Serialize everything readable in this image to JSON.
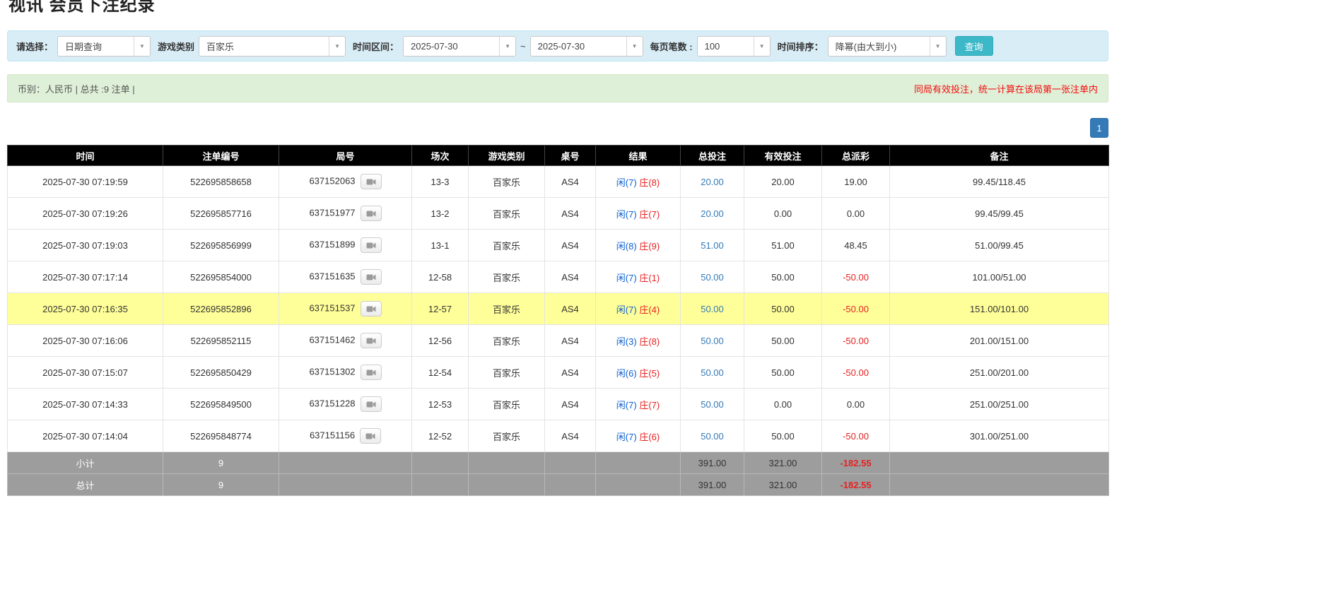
{
  "page": {
    "title": "视讯 会员下注纪录"
  },
  "icons": {
    "caret": "▼",
    "replay": "video-replay",
    "replay_color": "#9a9a9a"
  },
  "colors": {
    "filter_bar_bg": "#d9edf7",
    "summary_bar_bg": "#dff0d8",
    "query_button": "#3cb8c8",
    "pagination_blue": "#337ab7",
    "highlight_row": "#ffff99",
    "player_blue": "#0b5fd0",
    "banker_red": "#e62222",
    "negative_red": "#e62222",
    "header_bg": "#000000",
    "footer_bg": "#9d9d9d"
  },
  "filters": {
    "select_label": "请选择：",
    "select_value": "日期查询",
    "game_type_label": "游戏类别",
    "game_type_value": "百家乐",
    "time_range_label": "时间区间：",
    "time_from": "2025-07-30",
    "tilde": "~",
    "time_to": "2025-07-30",
    "page_size_label": "每页笔数 :",
    "page_size_value": "100",
    "sort_label": "时间排序：",
    "sort_value": "降幂(由大到小)",
    "query_button": "查询"
  },
  "summary": {
    "left": "币别：人民币 | 总共 :9 注单 |",
    "right": "同局有效投注，统一计算在该局第一张注单内"
  },
  "pagination": {
    "current": "1"
  },
  "table": {
    "headers": [
      "时间",
      "注单编号",
      "局号",
      "场次",
      "游戏类别",
      "桌号",
      "结果",
      "总投注",
      "有效投注",
      "总派彩",
      "备注"
    ],
    "rows": [
      {
        "time": "2025-07-30 07:19:59",
        "bet_id": "522695858658",
        "round_id": "637152063",
        "session": "13-3",
        "game": "百家乐",
        "table_no": "AS4",
        "result_player": "闲(7)",
        "result_banker": "庄(8)",
        "total_bet": "20.00",
        "valid_bet": "20.00",
        "payout": "19.00",
        "note": "99.45/118.45",
        "highlight": false
      },
      {
        "time": "2025-07-30 07:19:26",
        "bet_id": "522695857716",
        "round_id": "637151977",
        "session": "13-2",
        "game": "百家乐",
        "table_no": "AS4",
        "result_player": "闲(7)",
        "result_banker": "庄(7)",
        "total_bet": "20.00",
        "valid_bet": "0.00",
        "payout": "0.00",
        "note": "99.45/99.45",
        "highlight": false
      },
      {
        "time": "2025-07-30 07:19:03",
        "bet_id": "522695856999",
        "round_id": "637151899",
        "session": "13-1",
        "game": "百家乐",
        "table_no": "AS4",
        "result_player": "闲(8)",
        "result_banker": "庄(9)",
        "total_bet": "51.00",
        "valid_bet": "51.00",
        "payout": "48.45",
        "note": "51.00/99.45",
        "highlight": false
      },
      {
        "time": "2025-07-30 07:17:14",
        "bet_id": "522695854000",
        "round_id": "637151635",
        "session": "12-58",
        "game": "百家乐",
        "table_no": "AS4",
        "result_player": "闲(7)",
        "result_banker": "庄(1)",
        "total_bet": "50.00",
        "valid_bet": "50.00",
        "payout": "-50.00",
        "note": "101.00/51.00",
        "highlight": false
      },
      {
        "time": "2025-07-30 07:16:35",
        "bet_id": "522695852896",
        "round_id": "637151537",
        "session": "12-57",
        "game": "百家乐",
        "table_no": "AS4",
        "result_player": "闲(7)",
        "result_banker": "庄(4)",
        "total_bet": "50.00",
        "valid_bet": "50.00",
        "payout": "-50.00",
        "note": "151.00/101.00",
        "highlight": true
      },
      {
        "time": "2025-07-30 07:16:06",
        "bet_id": "522695852115",
        "round_id": "637151462",
        "session": "12-56",
        "game": "百家乐",
        "table_no": "AS4",
        "result_player": "闲(3)",
        "result_banker": "庄(8)",
        "total_bet": "50.00",
        "valid_bet": "50.00",
        "payout": "-50.00",
        "note": "201.00/151.00",
        "highlight": false
      },
      {
        "time": "2025-07-30 07:15:07",
        "bet_id": "522695850429",
        "round_id": "637151302",
        "session": "12-54",
        "game": "百家乐",
        "table_no": "AS4",
        "result_player": "闲(6)",
        "result_banker": "庄(5)",
        "total_bet": "50.00",
        "valid_bet": "50.00",
        "payout": "-50.00",
        "note": "251.00/201.00",
        "highlight": false
      },
      {
        "time": "2025-07-30 07:14:33",
        "bet_id": "522695849500",
        "round_id": "637151228",
        "session": "12-53",
        "game": "百家乐",
        "table_no": "AS4",
        "result_player": "闲(7)",
        "result_banker": "庄(7)",
        "total_bet": "50.00",
        "valid_bet": "0.00",
        "payout": "0.00",
        "note": "251.00/251.00",
        "highlight": false
      },
      {
        "time": "2025-07-30 07:14:04",
        "bet_id": "522695848774",
        "round_id": "637151156",
        "session": "12-52",
        "game": "百家乐",
        "table_no": "AS4",
        "result_player": "闲(7)",
        "result_banker": "庄(6)",
        "total_bet": "50.00",
        "valid_bet": "50.00",
        "payout": "-50.00",
        "note": "301.00/251.00",
        "highlight": false
      }
    ],
    "subtotal": {
      "label": "小计",
      "count": "9",
      "total_bet": "391.00",
      "valid_bet": "321.00",
      "payout": "-182.55"
    },
    "total": {
      "label": "总计",
      "count": "9",
      "total_bet": "391.00",
      "valid_bet": "321.00",
      "payout": "-182.55"
    }
  }
}
